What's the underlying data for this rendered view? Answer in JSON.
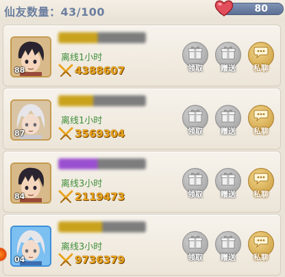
{
  "header": {
    "friend_count_label": "仙友数量：43/100",
    "hearts": "80"
  },
  "buttons": {
    "claim": "领取",
    "gift": "赠送",
    "chat": "私聊"
  },
  "friends": [
    {
      "level": "88",
      "status": "离线1小时",
      "power": "4388607"
    },
    {
      "level": "87",
      "status": "离线1小时",
      "power": "3569304"
    },
    {
      "level": "84",
      "status": "离线3小时",
      "power": "2119473"
    },
    {
      "level": "04",
      "status": "离线3小时",
      "power": "9736379"
    }
  ],
  "colors": {
    "title": "#6b7ea0",
    "status": "#3f8e3a",
    "power": "#e8a31d",
    "heart": "#e24e5b"
  }
}
